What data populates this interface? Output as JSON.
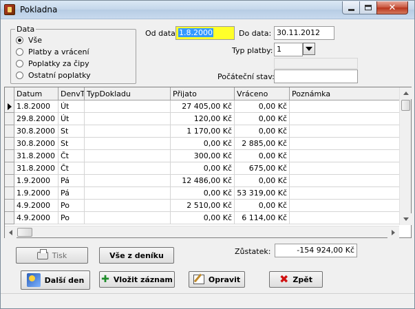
{
  "window": {
    "title": "Pokladna"
  },
  "filter": {
    "legend": "Data",
    "options": [
      {
        "label": "Vše",
        "selected": true
      },
      {
        "label": "Platby a vrácení",
        "selected": false
      },
      {
        "label": "Poplatky za čipy",
        "selected": false
      },
      {
        "label": "Ostatní poplatky",
        "selected": false
      }
    ]
  },
  "form": {
    "from_label": "Od data:",
    "from_value": "1.8.2000",
    "to_label": "Do data:",
    "to_value": "30.11.2012",
    "payment_type_label": "Typ platby:",
    "payment_type_value": "1",
    "initial_state_label": "Počáteční stav:",
    "initial_state_value": ""
  },
  "table": {
    "columns": [
      "Datum",
      "DenvT",
      "TypDokladu",
      "Přijato",
      "Vráceno",
      "Poznámka"
    ],
    "rows": [
      [
        "1.8.2000",
        "Út",
        "",
        "27 405,00 Kč",
        "0,00 Kč",
        ""
      ],
      [
        "29.8.2000",
        "Út",
        "",
        "120,00 Kč",
        "0,00 Kč",
        ""
      ],
      [
        "30.8.2000",
        "St",
        "",
        "1 170,00 Kč",
        "0,00 Kč",
        ""
      ],
      [
        "30.8.2000",
        "St",
        "",
        "0,00 Kč",
        "2 885,00 Kč",
        ""
      ],
      [
        "31.8.2000",
        "Čt",
        "",
        "300,00 Kč",
        "0,00 Kč",
        ""
      ],
      [
        "31.8.2000",
        "Čt",
        "",
        "0,00 Kč",
        "675,00 Kč",
        ""
      ],
      [
        "1.9.2000",
        "Pá",
        "",
        "12 486,00 Kč",
        "0,00 Kč",
        ""
      ],
      [
        "1.9.2000",
        "Pá",
        "",
        "0,00 Kč",
        "53 319,00 Kč",
        ""
      ],
      [
        "4.9.2000",
        "Po",
        "",
        "2 510,00 Kč",
        "0,00 Kč",
        ""
      ],
      [
        "4.9.2000",
        "Po",
        "",
        "0,00 Kč",
        "6 114,00 Kč",
        ""
      ]
    ],
    "current_row": 0
  },
  "balance": {
    "label": "Zůstatek:",
    "value": "-154 924,00 Kč"
  },
  "buttons": {
    "print": "Tisk",
    "all_from_diary": "Vše z deníku",
    "next_day": "Další den",
    "insert_record": "Vložit záznam",
    "edit": "Opravit",
    "back": "Zpět"
  }
}
